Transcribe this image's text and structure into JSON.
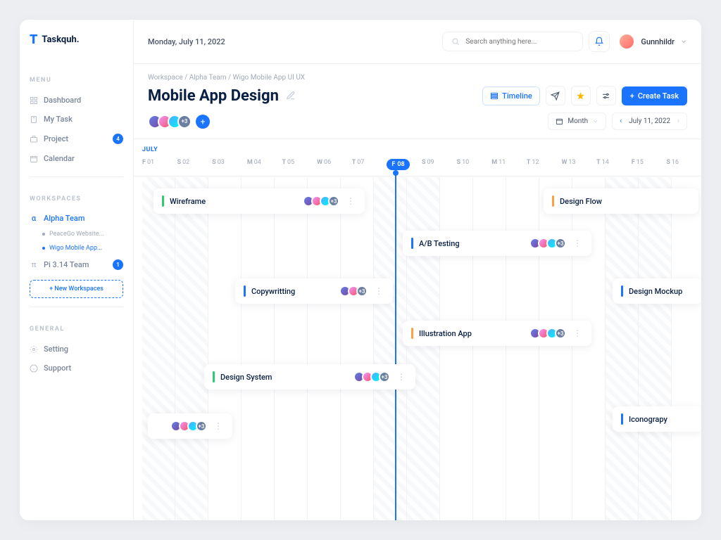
{
  "app": {
    "name": "Taskquh."
  },
  "topbar": {
    "date": "Monday, July 11, 2022",
    "search_placeholder": "Search anything here...",
    "username": "Gunnhildr"
  },
  "sidebar": {
    "menu_label": "MENU",
    "items": [
      {
        "label": "Dashboard"
      },
      {
        "label": "My Task"
      },
      {
        "label": "Project",
        "badge": "4"
      },
      {
        "label": "Calendar"
      }
    ],
    "workspaces_label": "WORKSPACES",
    "workspaces": [
      {
        "label": "Alpha Team",
        "active": true,
        "children": [
          {
            "label": "PeaceGo Website..."
          },
          {
            "label": "Wigo Mobile App...",
            "active": true
          }
        ]
      },
      {
        "label": "Pi 3.14 Team",
        "badge": "1"
      }
    ],
    "new_ws": "+   New Workspaces",
    "general_label": "GENERAL",
    "general": [
      {
        "label": "Setting"
      },
      {
        "label": "Support"
      }
    ]
  },
  "header": {
    "breadcrumb": "Workspace  /  Alpha Team  /  Wigo Mobile App UI UX",
    "title": "Mobile App Design",
    "timeline_btn": "Timeline",
    "create_btn": "Create Task",
    "avatars_more": "+3",
    "month_dropdown": "Month",
    "date_nav": "July 11, 2022"
  },
  "timeline": {
    "month": "JULY",
    "days": [
      {
        "d": "F",
        "n": "01"
      },
      {
        "d": "S",
        "n": "02"
      },
      {
        "d": "S",
        "n": "03"
      },
      {
        "d": "M",
        "n": "04"
      },
      {
        "d": "T",
        "n": "05"
      },
      {
        "d": "W",
        "n": "06"
      },
      {
        "d": "T",
        "n": "07"
      },
      {
        "d": "F",
        "n": "08",
        "today": true
      },
      {
        "d": "S",
        "n": "09"
      },
      {
        "d": "S",
        "n": "10"
      },
      {
        "d": "M",
        "n": "11"
      },
      {
        "d": "T",
        "n": "12"
      },
      {
        "d": "W",
        "n": "13"
      },
      {
        "d": "T",
        "n": "14"
      },
      {
        "d": "F",
        "n": "15"
      },
      {
        "d": "S",
        "n": "16"
      }
    ],
    "tasks": [
      {
        "title": "Wireframe",
        "color": "green",
        "more": "+3"
      },
      {
        "title": "Design Flow",
        "color": "orange"
      },
      {
        "title": "A/B Testing",
        "color": "blue",
        "more": "+3"
      },
      {
        "title": "Copywritting",
        "color": "blue",
        "more": "+3"
      },
      {
        "title": "Illustration App",
        "color": "orange",
        "more": "+3"
      },
      {
        "title": "Design System",
        "color": "green",
        "more": "+3"
      },
      {
        "title": "Iconograpy",
        "color": "blue"
      },
      {
        "title": "Design Mockup",
        "color": "blue"
      }
    ],
    "orphan_more": "+3"
  }
}
